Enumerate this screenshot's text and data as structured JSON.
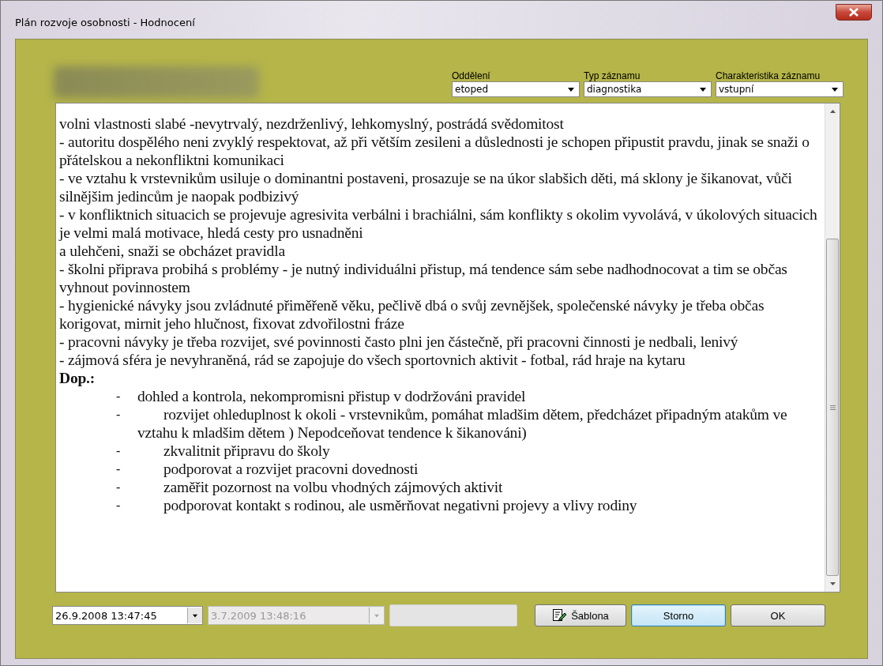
{
  "window": {
    "title": "Plán rozvoje osobnosti - Hodnocení"
  },
  "filters": [
    {
      "label": "Oddělení",
      "value": "etoped"
    },
    {
      "label": "Typ záznamu",
      "value": "diagnostika"
    },
    {
      "label": "Charakteristika záznamu",
      "value": "vstupní"
    }
  ],
  "text": {
    "paragraphs": [
      "volni vlastnosti slabé -nevytrvalý, nezdrženlivý, lehkomyslný, postrádá svědomitost",
      "- autoritu dospělého neni zvyklý respektovat, až při větším zesileni a důslednosti je schopen připustit pravdu, jinak se snaži o přátelskou a nekonfliktni komunikaci",
      "- ve vztahu k vrstevnikům usiluje o dominantni postaveni, prosazuje se na úkor slabšich děti, má sklony je šikanovat, vůči silnějšim  jedincům je naopak podbizivý",
      "- v konfliktnich situacich se projevuje agresivita verbálni i brachiálni, sám konflikty s okolim vyvolává, v úkolových situacich je velmi malá motivace, hledá cesty pro usnadněni",
      "a ulehčeni, snaži se obcházet pravidla",
      "- školni připrava probihá s problémy - je nutný individuálni přistup, má tendence sám sebe nadhodnocovat a tim se občas vyhnout povinnostem",
      "- hygienické návyky jsou zvládnuté přiměřeně věku, pečlivě dbá o svůj zevnějšek, společenské návyky je třeba občas korigovat, mirnit jeho hlučnost, fixovat zdvořilostni fráze",
      "- pracovni návyky je třeba rozvijet, své povinnosti často plni jen částečně, při pracovni činnosti je nedbali, lenivý",
      "- zájmová sféra je nevyhraněná, rád se zapojuje do všech sportovnich aktivit - fotbal, rád hraje na kytaru"
    ],
    "heading": "Dop.:",
    "items": [
      {
        "dash": "-",
        "text": "dohled a kontrola, nekompromisni přistup v dodržováni pravidel",
        "tab": false
      },
      {
        "dash": "-",
        "text": "rozvijet ohleduplnost k okoli - vrstevnikům, pomáhat mladšim dětem, předcházet připadným atakům ve vztahu k mladšim dětem ) Nepodceňovat tendence k šikanováni)",
        "tab": true
      },
      {
        "dash": "-",
        "text": "zkvalitnit připravu do školy",
        "tab": true
      },
      {
        "dash": "-",
        "text": "podporovat a rozvijet pracovni dovednosti",
        "tab": true
      },
      {
        "dash": "-",
        "text": "zaměřit pozornost na volbu vhodných zájmových aktivit",
        "tab": true
      },
      {
        "dash": "-",
        "text": "podporovat kontakt s rodinou, ale usměrňovat negativni projevy a vlivy rodiny",
        "tab": true
      }
    ]
  },
  "dates": [
    {
      "value": "26.9.2008 13:47:45",
      "disabled": false
    },
    {
      "value": "3.7.2009 13:48:16",
      "disabled": true
    }
  ],
  "buttons": [
    {
      "label": "Šablona",
      "kind": "template",
      "focused": false
    },
    {
      "label": "Storno",
      "kind": "plain",
      "focused": true
    },
    {
      "label": "OK",
      "kind": "plain",
      "focused": false
    }
  ]
}
